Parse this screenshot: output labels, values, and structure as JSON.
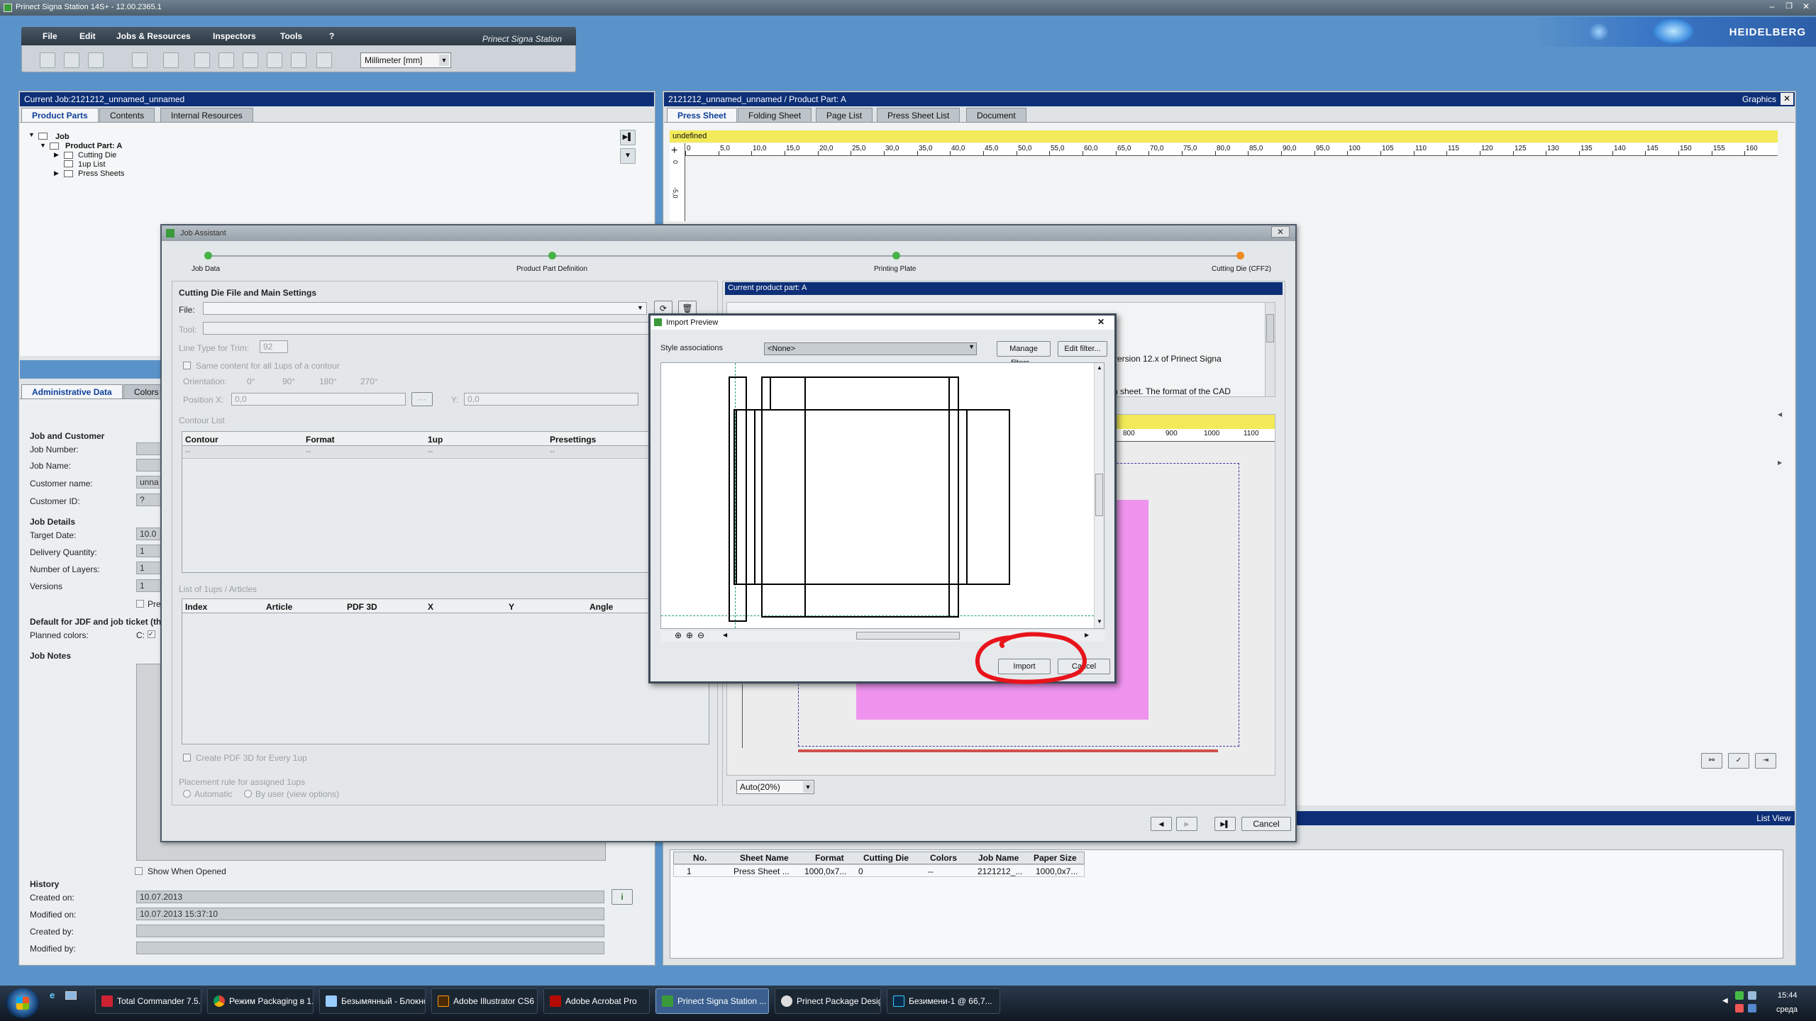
{
  "window": {
    "title": "Prinect Signa Station 14S+ - 12.00.2365.1",
    "brand": "HEIDELBERG",
    "tagline": "Prinect Signa Station"
  },
  "menu": [
    "File",
    "Edit",
    "Jobs & Resources",
    "Inspectors",
    "Tools",
    "?"
  ],
  "toolbar": {
    "unit": "Millimeter [mm]"
  },
  "left_panel": {
    "title": "Current Job:2121212_unnamed_unnamed",
    "tabs": [
      "Product Parts",
      "Contents",
      "Internal Resources"
    ],
    "tree": {
      "job": "Job",
      "part": "Product Part: A",
      "children": [
        "Cutting Die",
        "1up List",
        "Press Sheets"
      ]
    },
    "bottom_tabs": [
      "Administrative Data",
      "Colors"
    ],
    "sections": {
      "job_customer": "Job and Customer",
      "job_details": "Job Details",
      "default_jdf": "Default for JDF and job ticket (thi",
      "job_notes": "Job Notes",
      "history": "History"
    },
    "fields": {
      "job_number": "Job Number:",
      "job_name": "Job Name:",
      "customer_name": "Customer name:",
      "customer_name_val": "unna",
      "customer_id": "Customer ID:",
      "customer_id_val": "?",
      "target_date": "Target Date:",
      "target_date_val": "10.0",
      "delivery_qty": "Delivery Quantity:",
      "delivery_qty_val": "1",
      "layers": "Number of Layers:",
      "layers_val": "1",
      "versions": "Versions",
      "versions_val": "1",
      "pre": "Pre",
      "planned_colors": "Planned colors:",
      "planned_colors_val": "C:"
    },
    "show_when_opened": "Show When Opened",
    "history": {
      "created_on": "Created on:",
      "created_on_val": "10.07.2013",
      "modified_on": "Modified on:",
      "modified_on_val": "10.07.2013  15:37:10",
      "created_by": "Created by:",
      "modified_by": "Modified by:"
    }
  },
  "right_panel": {
    "title": "2121212_unnamed_unnamed / Product Part: A",
    "graphics": "Graphics",
    "tabs": [
      "Press Sheet",
      "Folding Sheet",
      "Page List",
      "Press Sheet List",
      "Document"
    ],
    "status": "undefined",
    "ruler_top": [
      "0",
      "5,0",
      "10,0",
      "15,0",
      "20,0",
      "25,0",
      "30,0",
      "35,0",
      "40,0",
      "45,0",
      "50,0",
      "55,0",
      "60,0",
      "65,0",
      "70,0",
      "75,0",
      "80,0",
      "85,0",
      "90,0",
      "95,0",
      "100",
      "105",
      "110",
      "115",
      "120",
      "125",
      "130",
      "135",
      "140",
      "145",
      "150",
      "155",
      "160"
    ],
    "ruler_left": [
      "0",
      "-5,0"
    ],
    "list_view": "List View",
    "table": {
      "headers": [
        "No.",
        "Sheet Name",
        "Format",
        "Cutting Die",
        "Colors",
        "Job Name",
        "Paper Size"
      ],
      "rows": [
        [
          "1",
          "Press Sheet ...",
          "1000,0x7...",
          "0",
          "--",
          "2121212_...",
          "1000,0x7..."
        ]
      ]
    }
  },
  "job_assistant": {
    "title": "Job Assistant",
    "steps": [
      "Job Data",
      "Product Part Definition",
      "Printing Plate",
      "Cutting Die (CFF2)"
    ],
    "section": "Cutting Die File and Main Settings",
    "file": "File:",
    "tool": "Tool:",
    "line_type": "Line Type for Trim:",
    "line_type_val": "92",
    "same_content": "Same content for all 1ups of a contour",
    "orientation": "Orientation:",
    "orient": [
      "0°",
      "90°",
      "180°",
      "270°"
    ],
    "position_x": "Position X:",
    "pos_x_val": "0,0",
    "pos_y": "Y:",
    "pos_y_val": "0,0",
    "contour_list": "Contour List",
    "contour_headers": [
      "Contour",
      "Format",
      "1up",
      "Presettings"
    ],
    "contour_row": [
      "--",
      "--",
      "--",
      "--"
    ],
    "list_1ups": "List of 1ups / Articles",
    "list_headers": [
      "Index",
      "Article",
      "PDF 3D",
      "X",
      "Y",
      "Angle"
    ],
    "create_pdf": "Create PDF 3D for Every 1up",
    "placement": "Placement rule for assigned 1ups",
    "automatic": "Automatic",
    "by_user": "By user (view options)",
    "current_part": "Current product part: A",
    "info_text_1": "version 12.x of Prinect Signa",
    "info_text_2": "n sheet. The format of the CAD",
    "preview_ruler": [
      "800",
      "900",
      "1000",
      "1100"
    ],
    "zoom": "Auto(20%)",
    "cancel": "Cancel"
  },
  "import_preview": {
    "title": "Import Preview",
    "style_label": "Style associations",
    "style_value": "<None>",
    "manage_filters": "Manage filters...",
    "edit_filter": "Edit filter...",
    "import": "Import",
    "cancel": "Cancel"
  },
  "taskbar": {
    "items": [
      "Total Commander 7.5...",
      "Режим Packaging в 1...",
      "Безымянный - Блокнот",
      "Adobe Illustrator CS6",
      "Adobe Acrobat Pro",
      "Prinect Signa Station ...",
      "Prinect Package Desig...",
      "Безимени-1 @ 66,7..."
    ],
    "clock": "15:44",
    "day": "среда"
  }
}
